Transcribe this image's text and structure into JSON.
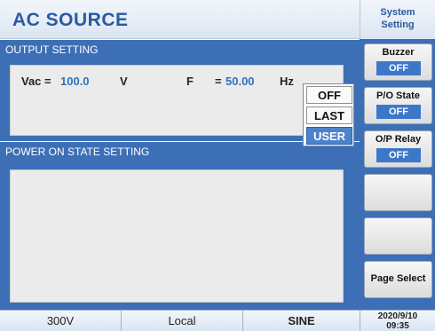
{
  "header": {
    "title": "AC SOURCE"
  },
  "output_setting": {
    "title": "OUTPUT SETTING",
    "vac_label": "Vac =",
    "vac_value": "100.0",
    "vac_unit": "V",
    "freq_label": "F",
    "freq_eq": "=",
    "freq_value": "50.00",
    "freq_unit": "Hz"
  },
  "power_on": {
    "title": "POWER ON STATE SETTING",
    "options": [
      "OFF",
      "LAST",
      "USER"
    ],
    "selected": "USER"
  },
  "sidebar": {
    "title_line1": "System",
    "title_line2": "Setting",
    "keys": [
      {
        "label": "Buzzer",
        "value": "OFF"
      },
      {
        "label": "P/O State",
        "value": "OFF"
      },
      {
        "label": "O/P Relay",
        "value": "OFF"
      },
      {
        "label": ""
      },
      {
        "label": ""
      },
      {
        "label": "Page Select"
      }
    ]
  },
  "status": {
    "range": "300V",
    "mode": "Local",
    "waveform": "SINE",
    "date": "2020/9/10",
    "time": "09:35"
  },
  "colors": {
    "panel_blue": "#3d6fb6",
    "value_blue": "#2f6fc2",
    "title_blue": "#2a5aa0"
  }
}
